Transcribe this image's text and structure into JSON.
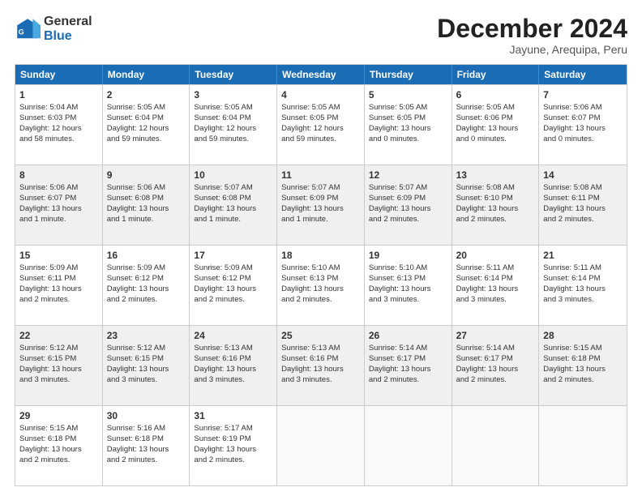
{
  "logo": {
    "general": "General",
    "blue": "Blue"
  },
  "title": "December 2024",
  "subtitle": "Jayune, Arequipa, Peru",
  "days": [
    "Sunday",
    "Monday",
    "Tuesday",
    "Wednesday",
    "Thursday",
    "Friday",
    "Saturday"
  ],
  "weeks": [
    [
      {
        "day": "1",
        "lines": [
          "Sunrise: 5:04 AM",
          "Sunset: 6:03 PM",
          "Daylight: 12 hours",
          "and 58 minutes."
        ]
      },
      {
        "day": "2",
        "lines": [
          "Sunrise: 5:05 AM",
          "Sunset: 6:04 PM",
          "Daylight: 12 hours",
          "and 59 minutes."
        ]
      },
      {
        "day": "3",
        "lines": [
          "Sunrise: 5:05 AM",
          "Sunset: 6:04 PM",
          "Daylight: 12 hours",
          "and 59 minutes."
        ]
      },
      {
        "day": "4",
        "lines": [
          "Sunrise: 5:05 AM",
          "Sunset: 6:05 PM",
          "Daylight: 12 hours",
          "and 59 minutes."
        ]
      },
      {
        "day": "5",
        "lines": [
          "Sunrise: 5:05 AM",
          "Sunset: 6:05 PM",
          "Daylight: 13 hours",
          "and 0 minutes."
        ]
      },
      {
        "day": "6",
        "lines": [
          "Sunrise: 5:05 AM",
          "Sunset: 6:06 PM",
          "Daylight: 13 hours",
          "and 0 minutes."
        ]
      },
      {
        "day": "7",
        "lines": [
          "Sunrise: 5:06 AM",
          "Sunset: 6:07 PM",
          "Daylight: 13 hours",
          "and 0 minutes."
        ]
      }
    ],
    [
      {
        "day": "8",
        "lines": [
          "Sunrise: 5:06 AM",
          "Sunset: 6:07 PM",
          "Daylight: 13 hours",
          "and 1 minute."
        ]
      },
      {
        "day": "9",
        "lines": [
          "Sunrise: 5:06 AM",
          "Sunset: 6:08 PM",
          "Daylight: 13 hours",
          "and 1 minute."
        ]
      },
      {
        "day": "10",
        "lines": [
          "Sunrise: 5:07 AM",
          "Sunset: 6:08 PM",
          "Daylight: 13 hours",
          "and 1 minute."
        ]
      },
      {
        "day": "11",
        "lines": [
          "Sunrise: 5:07 AM",
          "Sunset: 6:09 PM",
          "Daylight: 13 hours",
          "and 1 minute."
        ]
      },
      {
        "day": "12",
        "lines": [
          "Sunrise: 5:07 AM",
          "Sunset: 6:09 PM",
          "Daylight: 13 hours",
          "and 2 minutes."
        ]
      },
      {
        "day": "13",
        "lines": [
          "Sunrise: 5:08 AM",
          "Sunset: 6:10 PM",
          "Daylight: 13 hours",
          "and 2 minutes."
        ]
      },
      {
        "day": "14",
        "lines": [
          "Sunrise: 5:08 AM",
          "Sunset: 6:11 PM",
          "Daylight: 13 hours",
          "and 2 minutes."
        ]
      }
    ],
    [
      {
        "day": "15",
        "lines": [
          "Sunrise: 5:09 AM",
          "Sunset: 6:11 PM",
          "Daylight: 13 hours",
          "and 2 minutes."
        ]
      },
      {
        "day": "16",
        "lines": [
          "Sunrise: 5:09 AM",
          "Sunset: 6:12 PM",
          "Daylight: 13 hours",
          "and 2 minutes."
        ]
      },
      {
        "day": "17",
        "lines": [
          "Sunrise: 5:09 AM",
          "Sunset: 6:12 PM",
          "Daylight: 13 hours",
          "and 2 minutes."
        ]
      },
      {
        "day": "18",
        "lines": [
          "Sunrise: 5:10 AM",
          "Sunset: 6:13 PM",
          "Daylight: 13 hours",
          "and 2 minutes."
        ]
      },
      {
        "day": "19",
        "lines": [
          "Sunrise: 5:10 AM",
          "Sunset: 6:13 PM",
          "Daylight: 13 hours",
          "and 3 minutes."
        ]
      },
      {
        "day": "20",
        "lines": [
          "Sunrise: 5:11 AM",
          "Sunset: 6:14 PM",
          "Daylight: 13 hours",
          "and 3 minutes."
        ]
      },
      {
        "day": "21",
        "lines": [
          "Sunrise: 5:11 AM",
          "Sunset: 6:14 PM",
          "Daylight: 13 hours",
          "and 3 minutes."
        ]
      }
    ],
    [
      {
        "day": "22",
        "lines": [
          "Sunrise: 5:12 AM",
          "Sunset: 6:15 PM",
          "Daylight: 13 hours",
          "and 3 minutes."
        ]
      },
      {
        "day": "23",
        "lines": [
          "Sunrise: 5:12 AM",
          "Sunset: 6:15 PM",
          "Daylight: 13 hours",
          "and 3 minutes."
        ]
      },
      {
        "day": "24",
        "lines": [
          "Sunrise: 5:13 AM",
          "Sunset: 6:16 PM",
          "Daylight: 13 hours",
          "and 3 minutes."
        ]
      },
      {
        "day": "25",
        "lines": [
          "Sunrise: 5:13 AM",
          "Sunset: 6:16 PM",
          "Daylight: 13 hours",
          "and 3 minutes."
        ]
      },
      {
        "day": "26",
        "lines": [
          "Sunrise: 5:14 AM",
          "Sunset: 6:17 PM",
          "Daylight: 13 hours",
          "and 2 minutes."
        ]
      },
      {
        "day": "27",
        "lines": [
          "Sunrise: 5:14 AM",
          "Sunset: 6:17 PM",
          "Daylight: 13 hours",
          "and 2 minutes."
        ]
      },
      {
        "day": "28",
        "lines": [
          "Sunrise: 5:15 AM",
          "Sunset: 6:18 PM",
          "Daylight: 13 hours",
          "and 2 minutes."
        ]
      }
    ],
    [
      {
        "day": "29",
        "lines": [
          "Sunrise: 5:15 AM",
          "Sunset: 6:18 PM",
          "Daylight: 13 hours",
          "and 2 minutes."
        ]
      },
      {
        "day": "30",
        "lines": [
          "Sunrise: 5:16 AM",
          "Sunset: 6:18 PM",
          "Daylight: 13 hours",
          "and 2 minutes."
        ]
      },
      {
        "day": "31",
        "lines": [
          "Sunrise: 5:17 AM",
          "Sunset: 6:19 PM",
          "Daylight: 13 hours",
          "and 2 minutes."
        ]
      },
      {
        "day": "",
        "lines": []
      },
      {
        "day": "",
        "lines": []
      },
      {
        "day": "",
        "lines": []
      },
      {
        "day": "",
        "lines": []
      }
    ]
  ]
}
